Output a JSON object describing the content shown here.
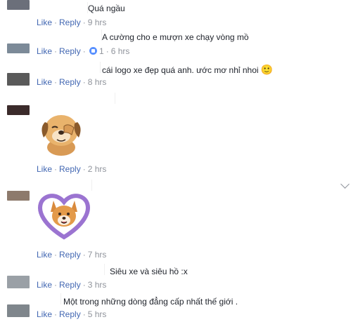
{
  "comments": [
    {
      "text": "Quá ngầu",
      "like": "Like",
      "reply": "Reply",
      "time": "9 hrs"
    },
    {
      "text": "A cường cho e mượn xe chạy vòng mồ",
      "like": "Like",
      "reply": "Reply",
      "reactions": "1",
      "time": "6 hrs"
    },
    {
      "text": "cái logo xe đẹp quá anh. ước mơ nhỉ nhoi",
      "like": "Like",
      "reply": "Reply",
      "time": "8 hrs",
      "emoji": "🙂"
    },
    {
      "sticker": "dog-facepalm-sticker",
      "like": "Like",
      "reply": "Reply",
      "time": "2 hrs"
    },
    {
      "sticker": "corgi-heart-sticker",
      "like": "Like",
      "reply": "Reply",
      "time": "7 hrs"
    },
    {
      "text": "Siêu xe và siêu hồ :x",
      "like": "Like",
      "reply": "Reply",
      "time": "3 hrs"
    },
    {
      "text": "Một trong những dòng đẳng cấp nhất thế giới .",
      "like": "Like",
      "reply": "Reply",
      "time": "5 hrs"
    }
  ],
  "dot": "·",
  "colors": {
    "link": "#4267b2",
    "meta": "#90949c",
    "text": "#1d2129",
    "like_badge": "#5890ff"
  }
}
